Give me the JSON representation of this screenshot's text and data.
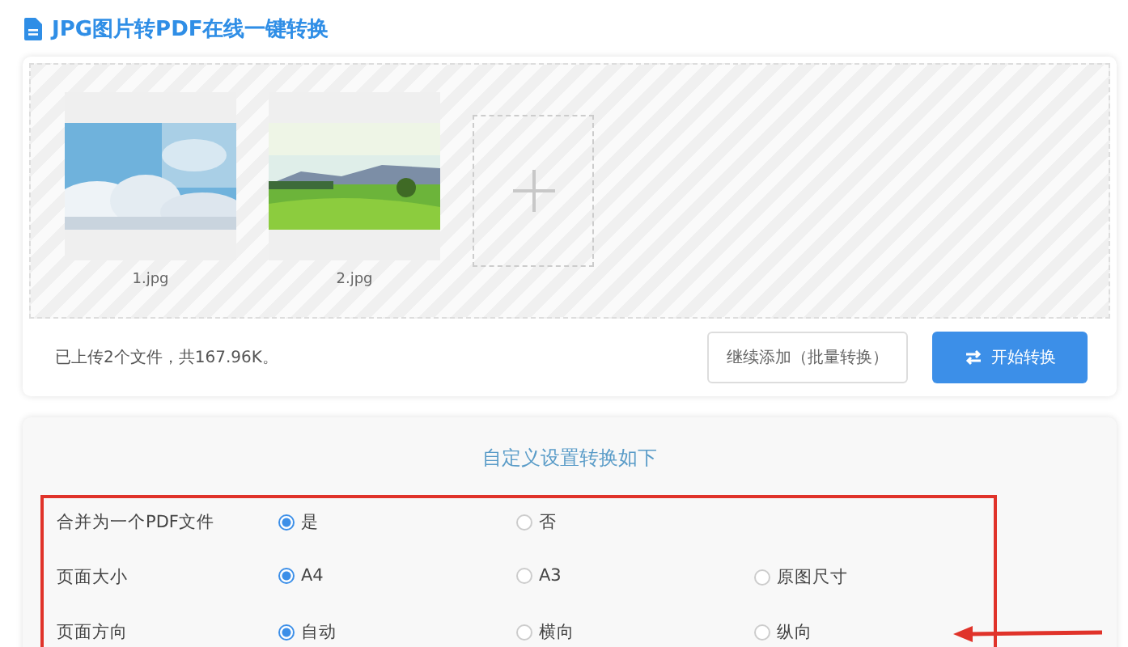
{
  "title": "JPG图片转PDF在线一键转换",
  "upload": {
    "files": [
      {
        "name": "1.jpg",
        "kind": "picture"
      },
      {
        "name": "2.jpg",
        "kind": "picture"
      }
    ],
    "summary": "已上传2个文件，共167.96K。",
    "buttons": [
      {
        "label": "继续添加（批量转换）",
        "kind": "secondary"
      },
      {
        "label": "开始转换",
        "kind": "primary"
      }
    ]
  },
  "settings": {
    "heading": "自定义设置转换如下",
    "rows": [
      {
        "label": "合并为一个PDF文件",
        "options": [
          {
            "label": "是",
            "selected": true
          },
          {
            "label": "否",
            "selected": false
          }
        ]
      },
      {
        "label": "页面大小",
        "options": [
          {
            "label": "A4",
            "selected": true
          },
          {
            "label": "A3",
            "selected": false
          },
          {
            "label": "原图尺寸",
            "selected": false
          }
        ]
      },
      {
        "label": "页面方向",
        "options": [
          {
            "label": "自动",
            "selected": true
          },
          {
            "label": "横向",
            "selected": false
          },
          {
            "label": "纵向",
            "selected": false
          }
        ]
      }
    ]
  }
}
